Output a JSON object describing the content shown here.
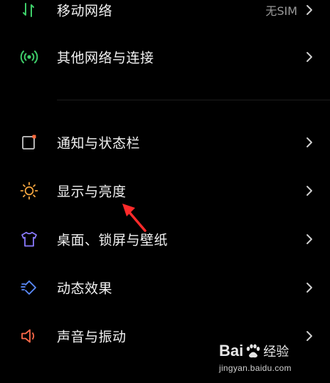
{
  "settings_list": {
    "items": [
      {
        "label": "移动网络",
        "value": "无SIM",
        "icon": "mobile-network-icon",
        "icon_color": "#3ecf6a"
      },
      {
        "label": "其他网络与连接",
        "icon": "connection-icon",
        "icon_color": "#3ecf6a"
      },
      {
        "label": "通知与状态栏",
        "icon": "notification-icon",
        "icon_color": "#c8c8c8",
        "icon_accent": "#ff6b3d"
      },
      {
        "label": "显示与亮度",
        "icon": "brightness-icon",
        "icon_color": "#f4a640"
      },
      {
        "label": "桌面、锁屏与壁纸",
        "icon": "wallpaper-icon",
        "icon_color": "#8a7bff"
      },
      {
        "label": "动态效果",
        "icon": "motion-effects-icon",
        "icon_color": "#5b8cff"
      },
      {
        "label": "声音与振动",
        "icon": "sound-icon",
        "icon_color": "#ff6a4a"
      }
    ]
  },
  "annotation": {
    "color": "#ff2a2a"
  },
  "watermark": {
    "logo_prefix": "Bai",
    "logo_suffix": "经验",
    "url": "jingyan.baidu.com"
  }
}
